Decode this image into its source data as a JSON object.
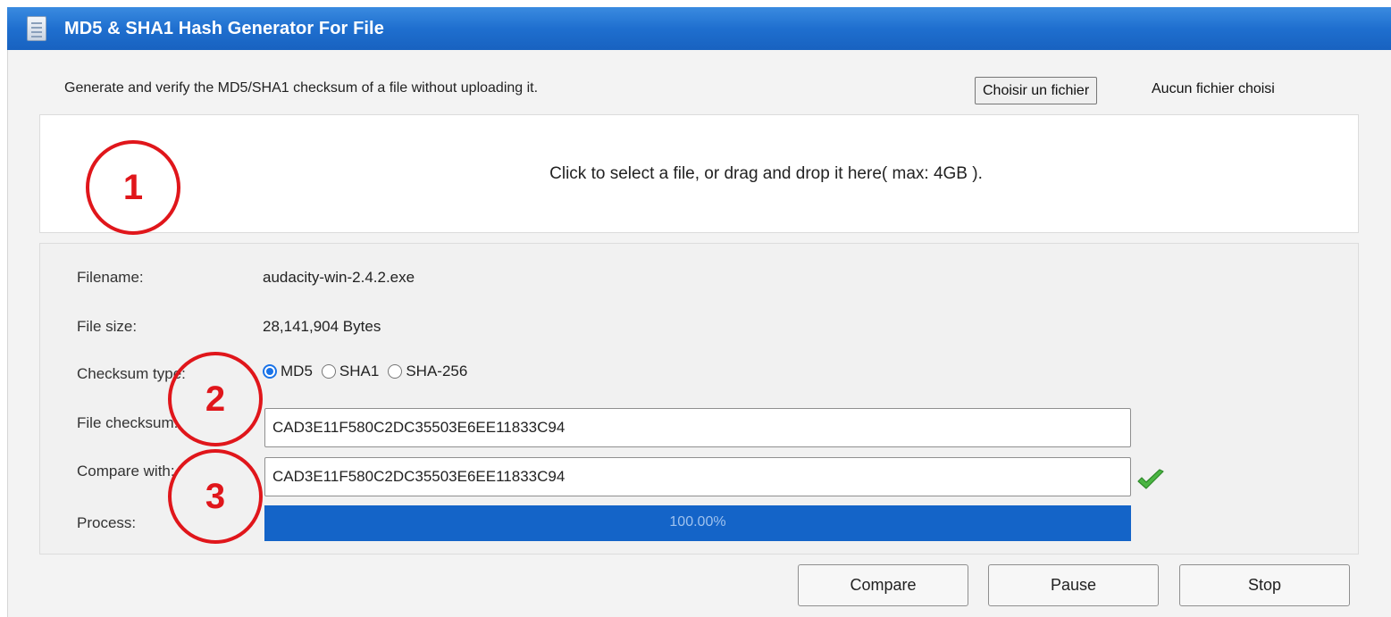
{
  "window": {
    "title": "MD5 & SHA1 Hash Generator For File",
    "icon": "document-icon"
  },
  "intro": {
    "description": "Generate and verify the MD5/SHA1 checksum of a file without uploading it.",
    "choose_file_label": "Choisir un fichier",
    "no_file_label": "Aucun fichier choisi"
  },
  "dropzone": {
    "text": "Click to select a file, or drag and drop it here( max: 4GB )."
  },
  "details": {
    "filename_label": "Filename:",
    "filename_value": "audacity-win-2.4.2.exe",
    "filesize_label": "File size:",
    "filesize_value": "28,141,904 Bytes",
    "checksum_type_label": "Checksum type:",
    "checksum_types": [
      {
        "label": "MD5",
        "checked": true
      },
      {
        "label": "SHA1",
        "checked": false
      },
      {
        "label": "SHA-256",
        "checked": false
      }
    ],
    "file_checksum_label": "File checksum:",
    "file_checksum_value": "CAD3E11F580C2DC35503E6EE11833C94",
    "compare_label": "Compare with:",
    "compare_value": "CAD3E11F580C2DC35503E6EE11833C94",
    "match_icon": "checkmark-icon",
    "process_label": "Process:",
    "progress_percent": 100,
    "progress_text": "100.00%"
  },
  "buttons": {
    "compare": "Compare",
    "pause": "Pause",
    "stop": "Stop"
  },
  "annotations": [
    "1",
    "2",
    "3"
  ],
  "colors": {
    "titlebar": "#1f6fcf",
    "progress_fill": "#1464c8",
    "annotation": "#e0161b",
    "radio_selected": "#1a73e8",
    "checkmark": "#3fa33b"
  }
}
